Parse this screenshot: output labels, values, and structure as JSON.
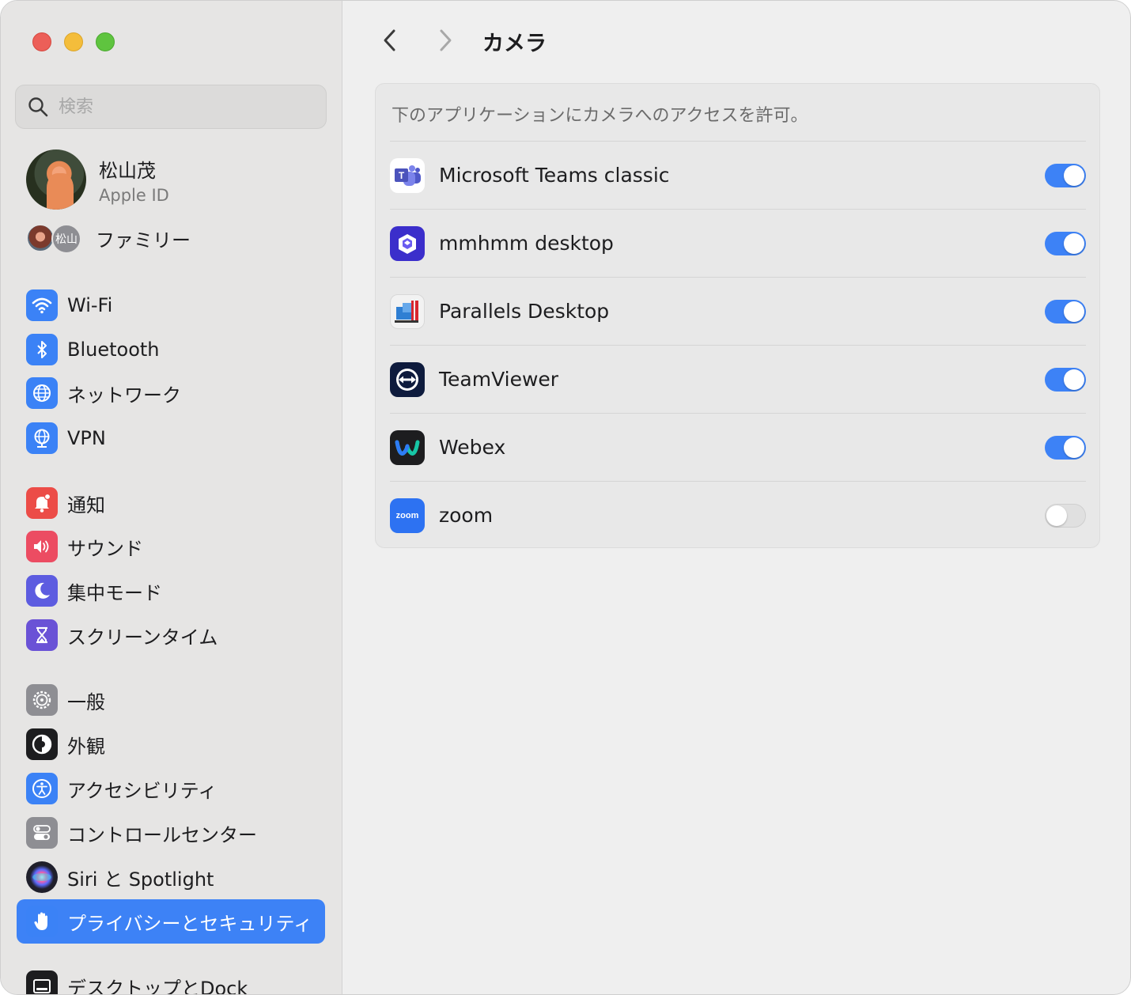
{
  "window": {
    "title": "カメラ",
    "colors": {
      "accent": "#3d82f6",
      "toggle_on": "#3d82f6",
      "toggle_off": "#e0e0e0"
    }
  },
  "sidebar": {
    "search_placeholder": "検索",
    "profile": {
      "name": "松山茂",
      "subtitle": "Apple ID"
    },
    "family": {
      "label": "ファミリー",
      "avatar_initials": "松山"
    },
    "items": [
      {
        "label": "Wi-Fi",
        "icon": "wifi-icon",
        "color": "#3b82f6"
      },
      {
        "label": "Bluetooth",
        "icon": "bluetooth-icon",
        "color": "#3b82f6"
      },
      {
        "label": "ネットワーク",
        "icon": "globe-icon",
        "color": "#3b82f6"
      },
      {
        "label": "VPN",
        "icon": "vpn-globe-icon",
        "color": "#3b82f6"
      },
      {
        "label": "通知",
        "icon": "bell-icon",
        "color": "#ec4c47"
      },
      {
        "label": "サウンド",
        "icon": "speaker-icon",
        "color": "#ec4c62"
      },
      {
        "label": "集中モード",
        "icon": "moon-icon",
        "color": "#5d5ce0"
      },
      {
        "label": "スクリーンタイム",
        "icon": "hourglass-icon",
        "color": "#6a52d6"
      },
      {
        "label": "一般",
        "icon": "gear-icon",
        "color": "#8e8e93"
      },
      {
        "label": "外観",
        "icon": "appearance-icon",
        "color": "#1d1d1f"
      },
      {
        "label": "アクセシビリティ",
        "icon": "accessibility-icon",
        "color": "#3b82f6"
      },
      {
        "label": "コントロールセンター",
        "icon": "control-center-icon",
        "color": "#8e8e93"
      },
      {
        "label": "Siri と Spotlight",
        "icon": "siri-icon",
        "color": "#2b2b3a"
      },
      {
        "label": "プライバシーとセキュリティ",
        "icon": "hand-icon",
        "color": "#3b82f6",
        "selected": true
      },
      {
        "label": "デスクトップとDock",
        "icon": "dock-icon",
        "color": "#1d1d1f"
      }
    ]
  },
  "main": {
    "description": "下のアプリケーションにカメラへのアクセスを許可。",
    "apps": [
      {
        "name": "Microsoft Teams classic",
        "icon": "teams-icon",
        "enabled": true
      },
      {
        "name": "mmhmm desktop",
        "icon": "mmhmm-icon",
        "enabled": true
      },
      {
        "name": "Parallels Desktop",
        "icon": "parallels-icon",
        "enabled": true
      },
      {
        "name": "TeamViewer",
        "icon": "teamviewer-icon",
        "enabled": true
      },
      {
        "name": "Webex",
        "icon": "webex-icon",
        "enabled": true
      },
      {
        "name": "zoom",
        "icon": "zoom-icon",
        "enabled": false,
        "icon_text": "zoom"
      }
    ]
  }
}
